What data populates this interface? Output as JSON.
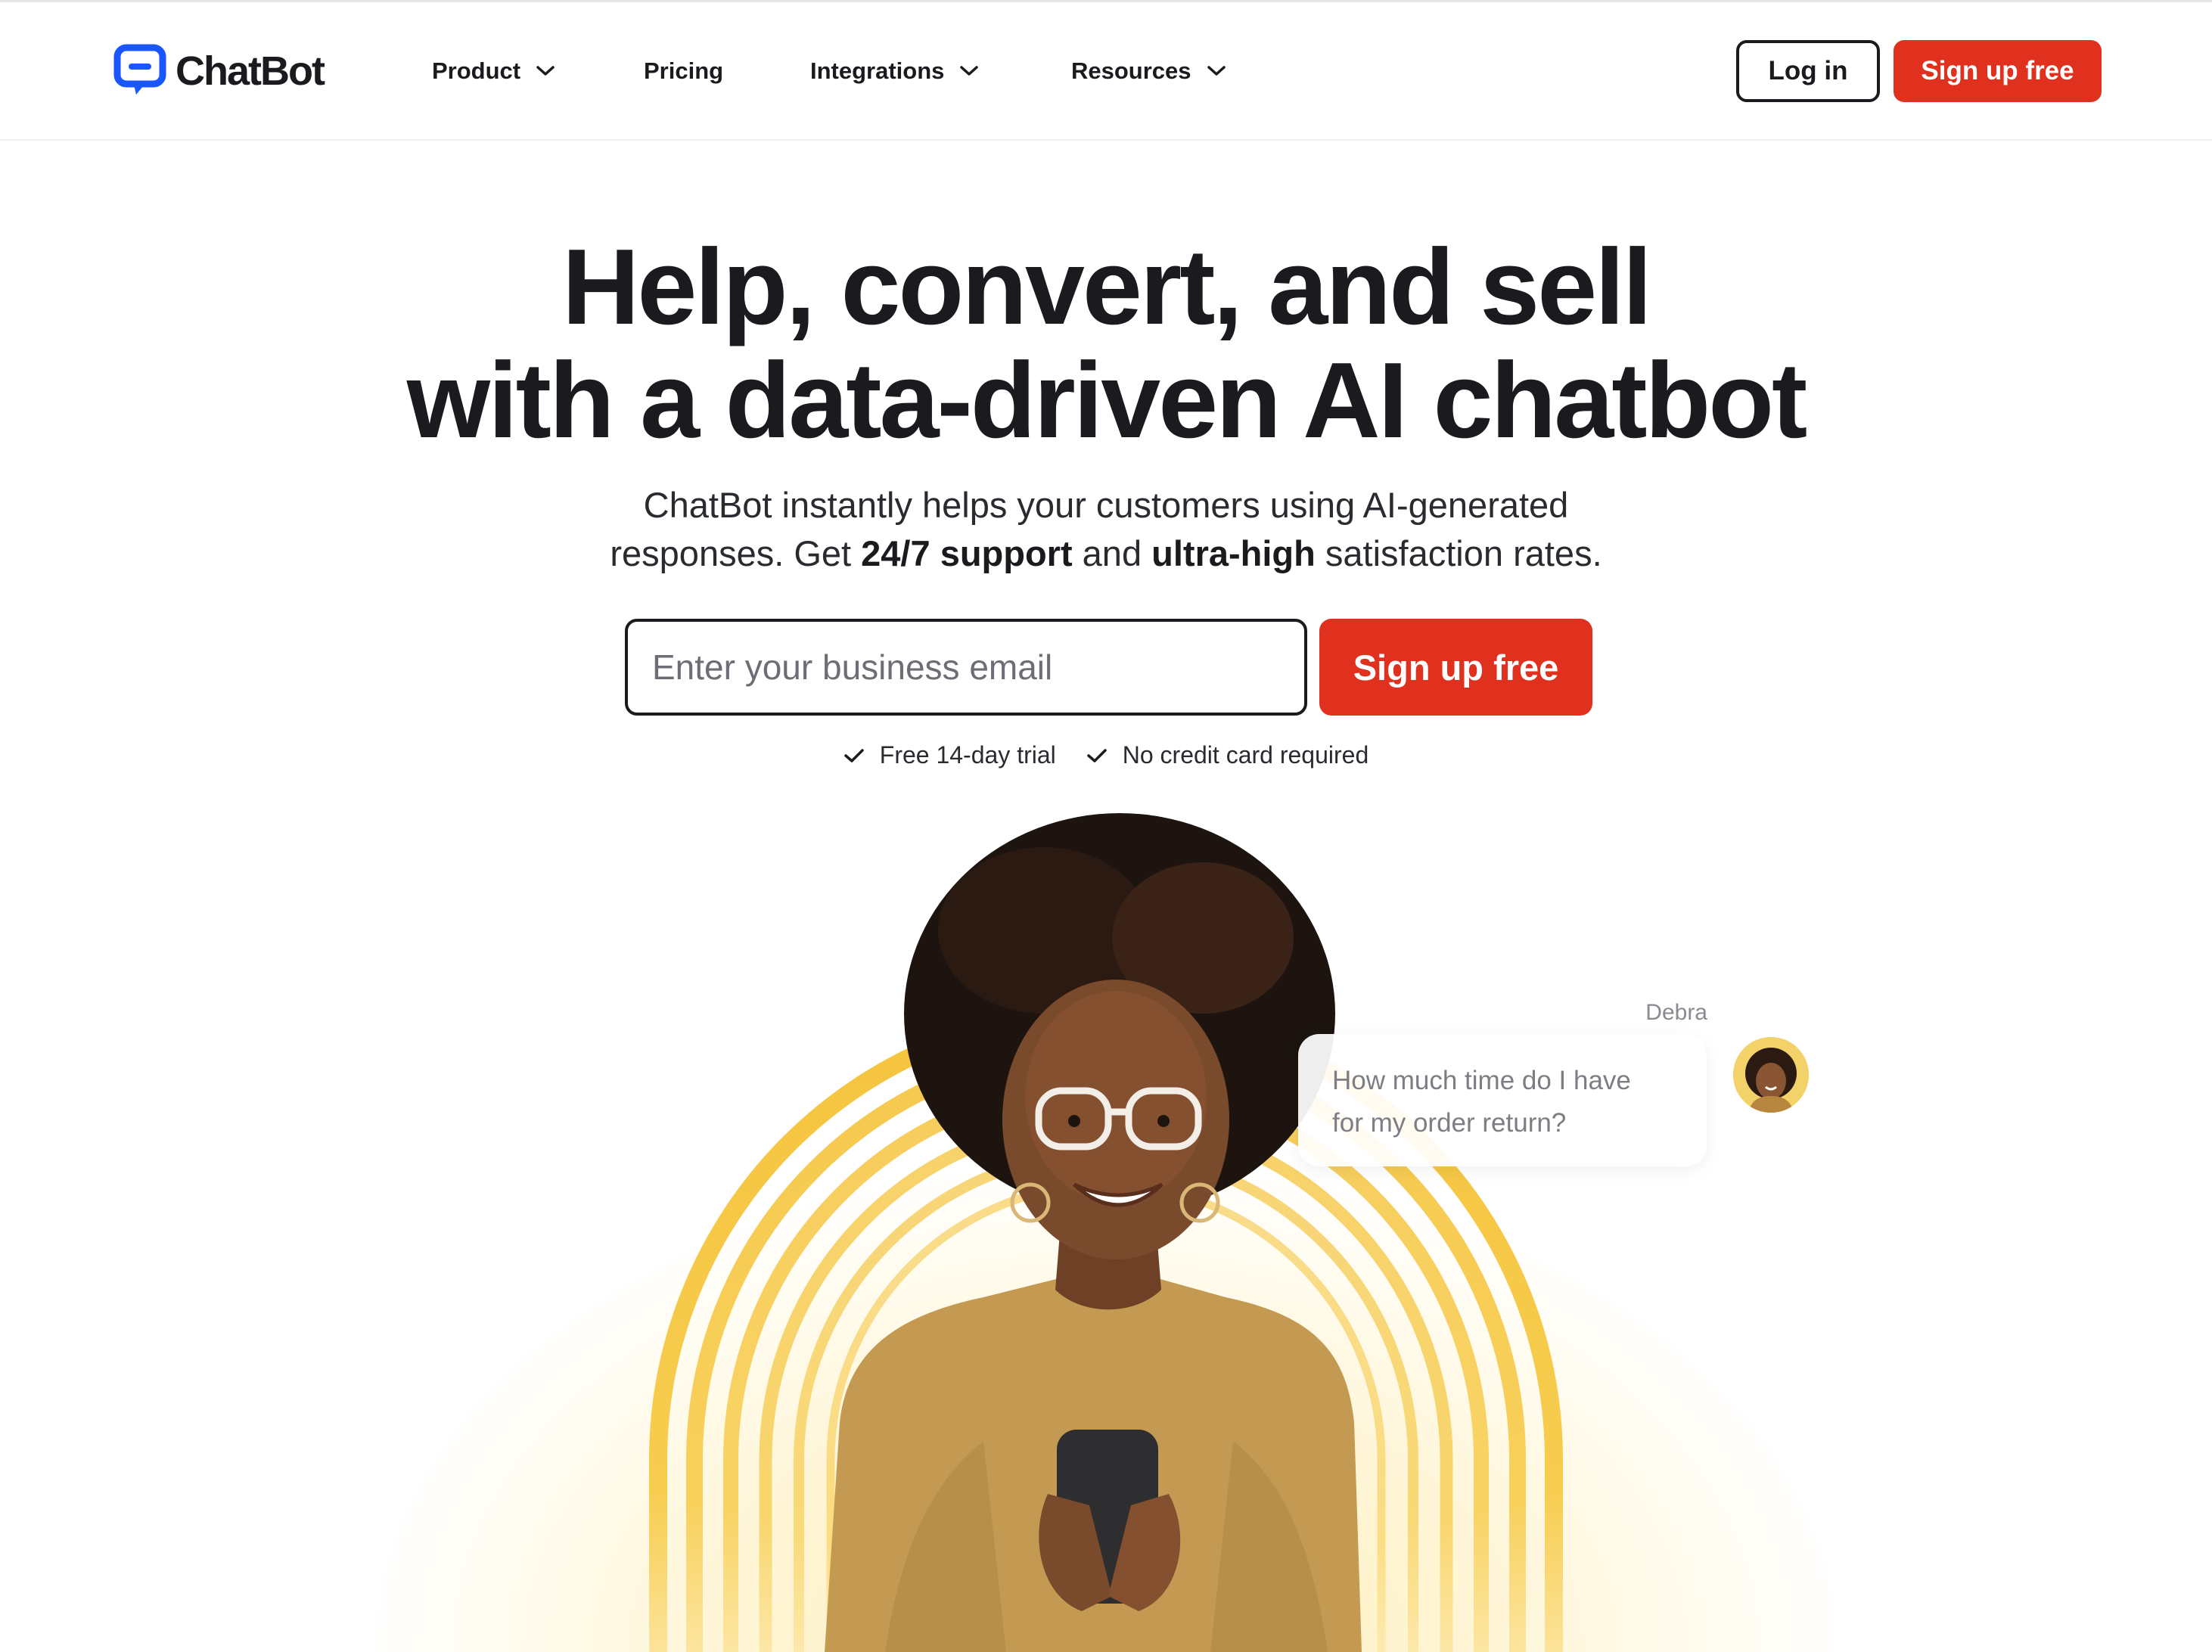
{
  "header": {
    "logo_text": "ChatBot",
    "nav": [
      {
        "label": "Product",
        "dropdown": true
      },
      {
        "label": "Pricing",
        "dropdown": false
      },
      {
        "label": "Integrations",
        "dropdown": true
      },
      {
        "label": "Resources",
        "dropdown": true
      }
    ],
    "login_label": "Log in",
    "signup_label": "Sign up free"
  },
  "hero": {
    "headline_line1": "Help, convert, and sell",
    "headline_line2": "with a data-driven AI chatbot",
    "sub_line1": "ChatBot instantly helps your customers using AI-generated",
    "sub_line2_pre": "responses. Get ",
    "sub_line2_bold1": "24/7 support",
    "sub_line2_mid": " and ",
    "sub_line2_bold2": "ultra-high",
    "sub_line2_post": " satisfaction rates.",
    "email_placeholder": "Enter your business email",
    "signup_label": "Sign up free",
    "perks": [
      "Free 14-day trial",
      "No credit card required"
    ]
  },
  "chat": {
    "sender": "Debra",
    "message_line1": "How much time do I have",
    "message_line2": "for my order return?"
  },
  "colors": {
    "brand_blue": "#1a56ff",
    "cta_red": "#e0301e",
    "arch_yellow": "#f5c43f"
  }
}
